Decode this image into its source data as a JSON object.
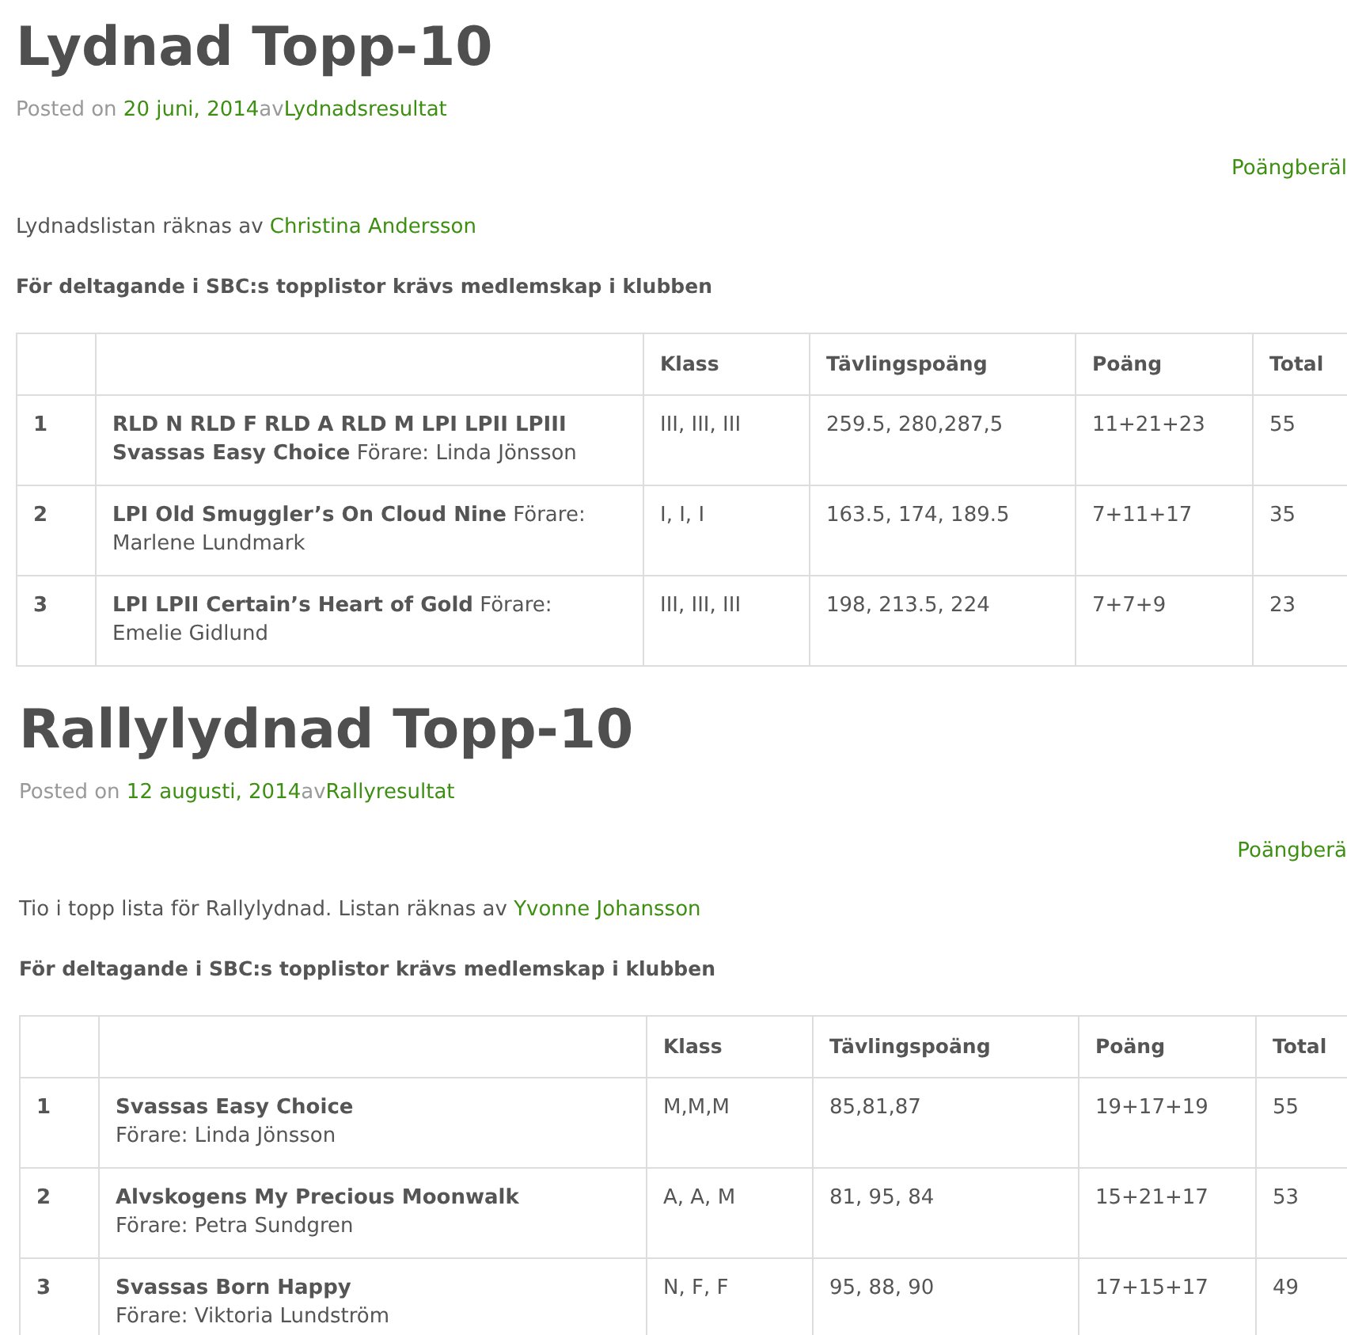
{
  "posts": [
    {
      "title": "Lydnad Topp-10",
      "posted_label": "Posted on",
      "date": "20 juni, 2014",
      "by": "av",
      "author": "Lydnadsresultat",
      "right_link": "Poängberäl",
      "intro": "Lydnadslistan räknas av ",
      "intro_link": "Christina Andersson",
      "notice": "För deltagande i SBC:s topplistor krävs medlemskap i klubben",
      "table": {
        "columns": [
          "Klass",
          "Tävlingspoäng",
          "Poäng",
          "Total"
        ],
        "rows": [
          {
            "rank": "1",
            "name": "**RLD N RLD F RLD A RLD M LPI LPII LPIII Svassas Easy Choice** Förare: Linda Jönsson",
            "klass": "III, III, III",
            "points": " 259.5, 280,287,5",
            "score": "11+21+23",
            "total": "55"
          },
          {
            "rank": "2",
            "name": "**LPI Old Smuggler’s On Cloud Nine** Förare: Marlene Lundmark",
            "klass": "I, I, I",
            "points": "163.5, 174, 189.5",
            "score": "7+11+17",
            "total": "35"
          },
          {
            "rank": "3",
            "name": "**LPI LPII Certain’s Heart of Gold** Förare: Emelie Gidlund",
            "klass": "III, III, III",
            "points": "198, 213.5, 224",
            "score": "7+7+9",
            "total": "23"
          }
        ]
      }
    },
    {
      "title": "Rallylydnad Topp-10",
      "posted_label": "Posted on",
      "date": "12 augusti, 2014",
      "by": "av",
      "author": "Rallyresultat",
      "right_link": "Poängberä",
      "intro": "Tio i topp lista för Rallylydnad. Listan räknas av ",
      "intro_link": "Yvonne Johansson",
      "notice": "För deltagande i SBC:s topplistor krävs medlemskap i klubben",
      "table": {
        "columns": [
          "Klass",
          "Tävlingspoäng",
          "Poäng",
          "Total"
        ],
        "rows": [
          {
            "rank": "1",
            "name": "**Svassas Easy Choice**\nFörare: Linda Jönsson",
            "klass": "M,M,M",
            "points": "85,81,87",
            "score": "19+17+19",
            "total": "55"
          },
          {
            "rank": "2",
            "name": "**Alvskogens My Precious Moonwalk**\nFörare: Petra Sundgren",
            "klass": "A, A, M",
            "points": "81, 95, 84",
            "score": "15+21+17",
            "total": "53"
          },
          {
            "rank": "3",
            "name": "**Svassas Born Happy**\nFörare: Viktoria Lundström",
            "klass": "N, F, F",
            "points": "95, 88, 90",
            "score": "17+15+17",
            "total": "49"
          }
        ]
      }
    }
  ]
}
